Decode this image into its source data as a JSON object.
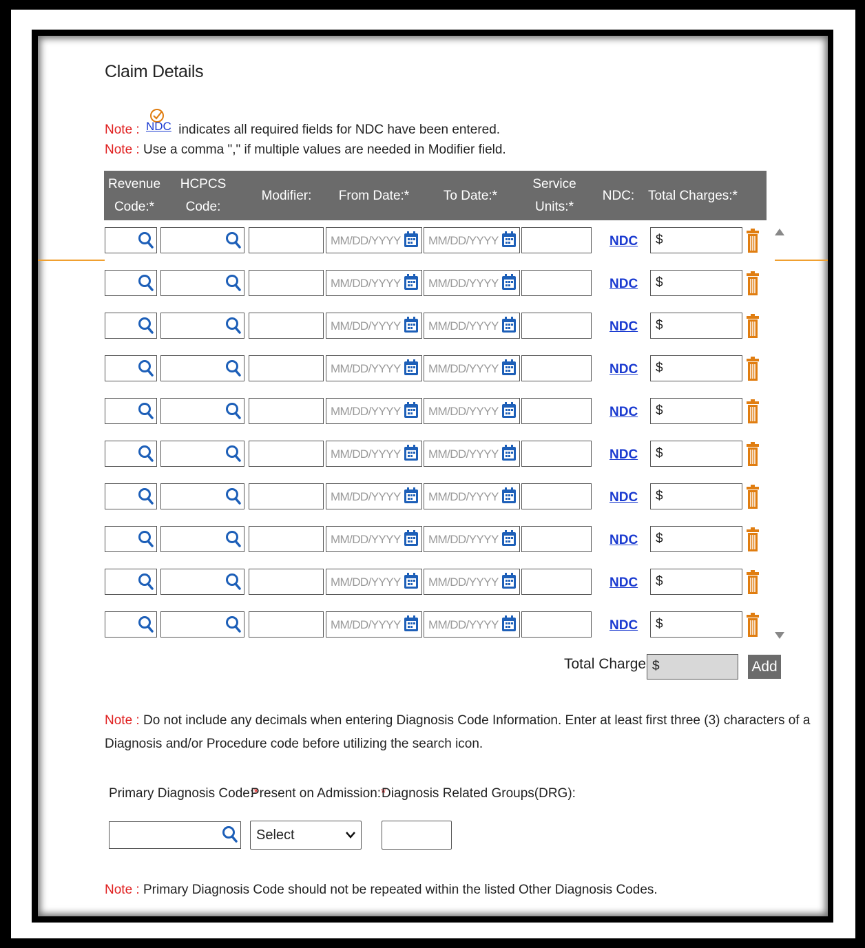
{
  "title": "Claim Details",
  "notes": {
    "label": "Note :",
    "ndc_icon_text": "NDC",
    "ndc_note": "indicates all required fields for NDC have been entered.",
    "modifier_note": "Use a comma \",\" if multiple values are needed in Modifier field.",
    "diagnosis_note_line1": "Do not include any decimals when entering Diagnosis Code Information. Enter at least first three (3) characters of a",
    "diagnosis_note_line2": "Diagnosis and/or Procedure code before utilizing the search icon.",
    "primary_note": "Primary Diagnosis Code should not be repeated within the listed Other Diagnosis Codes."
  },
  "table": {
    "headers": {
      "revenue_line1": "Revenue",
      "revenue_line2": "Code:*",
      "hcpcs": "HCPCS Code:",
      "modifier": "Modifier:",
      "from_date": "From Date:*",
      "to_date": "To Date:*",
      "units_line1": "Service",
      "units_line2": "Units:*",
      "ndc": "NDC:",
      "total": "Total Charges:*"
    },
    "row_count": 10,
    "date_placeholder": "MM/DD/YYYY",
    "ndc_link": "NDC",
    "currency": "$"
  },
  "totals": {
    "label": "Total Charges:",
    "value": "$",
    "add_label": "Add"
  },
  "diagnosis": {
    "primary_label": "Primary Diagnosis Code:",
    "poa_label": "Present on Admission:",
    "drg_label": "Diagnosis Related Groups(DRG):",
    "required_mark": "*",
    "poa_value": "Select"
  },
  "colors": {
    "header_bg": "#6b6b6b",
    "note_red": "#e02020",
    "link_blue": "#1a3ad0",
    "icon_blue": "#1d5fb8",
    "trash_orange": "#e07d10"
  }
}
